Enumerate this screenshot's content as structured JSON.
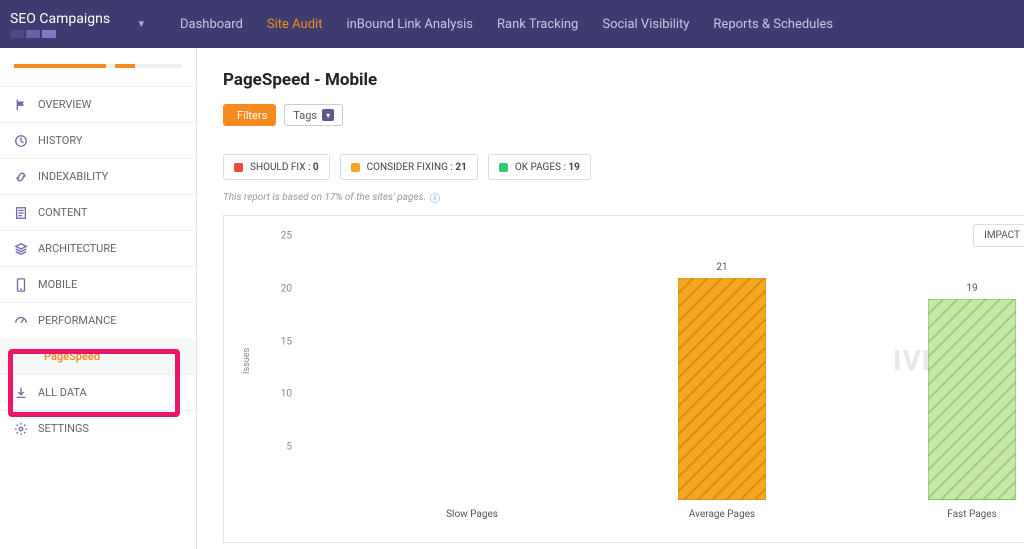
{
  "header": {
    "brand": "SEO Campaigns",
    "tabs": [
      "Dashboard",
      "Site Audit",
      "inBound Link Analysis",
      "Rank Tracking",
      "Social Visibility",
      "Reports & Schedules"
    ],
    "active_tab": 1
  },
  "sidebar": {
    "items": [
      {
        "label": "OVERVIEW",
        "icon": "flag"
      },
      {
        "label": "HISTORY",
        "icon": "clock"
      },
      {
        "label": "INDEXABILITY",
        "icon": "link"
      },
      {
        "label": "CONTENT",
        "icon": "doc"
      },
      {
        "label": "ARCHITECTURE",
        "icon": "layers"
      },
      {
        "label": "MOBILE",
        "icon": "phone"
      },
      {
        "label": "PERFORMANCE",
        "icon": "gauge",
        "active": true,
        "sub": "PageSpeed"
      },
      {
        "label": "ALL DATA",
        "icon": "download"
      },
      {
        "label": "SETTINGS",
        "icon": "gear"
      }
    ]
  },
  "page": {
    "title": "PageSpeed - Mobile",
    "filters_btn": "Filters",
    "tags_btn": "Tags",
    "legend": [
      {
        "label": "SHOULD FIX",
        "value": "0",
        "color": "r"
      },
      {
        "label": "CONSIDER FIXING",
        "value": "21",
        "color": "y"
      },
      {
        "label": "OK PAGES",
        "value": "19",
        "color": "g"
      }
    ],
    "note": "This report is based on 17% of the sites' pages.",
    "impact": "IMPACT",
    "watermark": "IVESEO"
  },
  "chart_data": {
    "type": "bar",
    "title": "",
    "xlabel": "",
    "ylabel": "Issues",
    "ylim": [
      0,
      25
    ],
    "yticks": [
      5,
      10,
      15,
      20,
      25
    ],
    "categories": [
      "Slow Pages",
      "Average Pages",
      "Fast Pages"
    ],
    "values": [
      0,
      21,
      19
    ],
    "colors": [
      "#e74c3c",
      "#f5a623",
      "#9ed27a"
    ]
  }
}
